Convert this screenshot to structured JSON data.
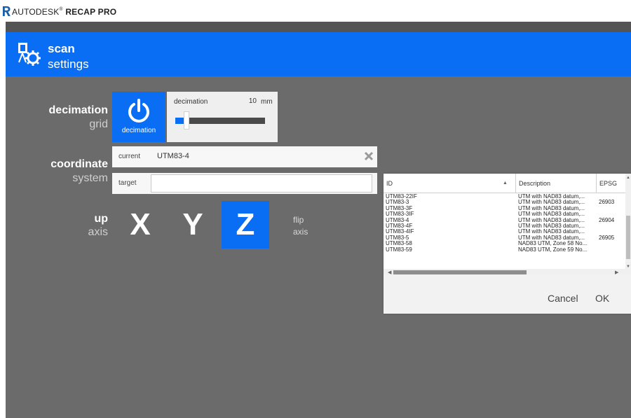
{
  "titlebar": {
    "brand_light": "AUTODESK",
    "reg_mark": "®",
    "brand_bold": "RECAP PRO"
  },
  "header": {
    "title": "scan",
    "subtitle": "settings"
  },
  "decimation": {
    "label_main": "decimation",
    "label_sub": "grid",
    "toggle_caption": "decimation",
    "slider_label": "decimation",
    "slider_value": "10",
    "slider_unit": "mm",
    "slider_fraction": 0.09
  },
  "coordinate": {
    "label_main": "coordinate",
    "label_sub": "system",
    "current_label": "current",
    "current_value": "UTM83-4",
    "target_label": "target",
    "target_value": ""
  },
  "up_axis": {
    "label_main": "up",
    "label_sub": "axis",
    "x_label": "X",
    "y_label": "Y",
    "z_label": "Z",
    "selected": "Z",
    "flip_main": "flip",
    "flip_sub": "axis"
  },
  "dropdown": {
    "columns": {
      "id": "ID",
      "description": "Description",
      "epsg": "EPSG"
    },
    "rows": [
      {
        "id": "UTM83-22IF",
        "description": "UTM with NAD83 datum,...",
        "epsg": ""
      },
      {
        "id": "UTM83-3",
        "description": "UTM with NAD83 datum,...",
        "epsg": "26903"
      },
      {
        "id": "UTM83-3F",
        "description": "UTM with NAD83 datum,...",
        "epsg": ""
      },
      {
        "id": "UTM83-3IF",
        "description": "UTM with NAD83 datum,...",
        "epsg": ""
      },
      {
        "id": "UTM83-4",
        "description": "UTM with NAD83 datum,...",
        "epsg": "26904"
      },
      {
        "id": "UTM83-4F",
        "description": "UTM with NAD83 datum,...",
        "epsg": ""
      },
      {
        "id": "UTM83-4IF",
        "description": "UTM with NAD83 datum,...",
        "epsg": ""
      },
      {
        "id": "UTM83-5",
        "description": "UTM with NAD83 datum,...",
        "epsg": "26905"
      },
      {
        "id": "UTM83-58",
        "description": "NAD83 UTM, Zone 58 No...",
        "epsg": ""
      },
      {
        "id": "UTM83-59",
        "description": "NAD83 UTM, Zone 59 No...",
        "epsg": ""
      }
    ],
    "cancel_label": "Cancel",
    "ok_label": "OK"
  },
  "colors": {
    "accent": "#0a6ef5",
    "background": "#6b6b6b",
    "panel": "#efefef"
  }
}
